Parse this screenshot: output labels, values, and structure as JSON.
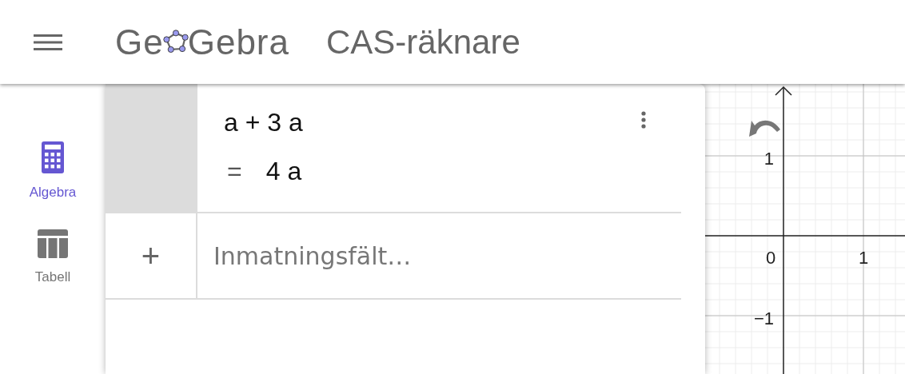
{
  "header": {
    "logo": [
      "Ge",
      "Gebra"
    ],
    "title": "CAS-räknare"
  },
  "sidebar": {
    "items": [
      {
        "label": "Algebra",
        "kind": "calculator",
        "selected": true
      },
      {
        "label": "Tabell",
        "kind": "table",
        "selected": false
      }
    ]
  },
  "cas": {
    "rows": [
      {
        "input": "a + 3 a",
        "output_sign": "=",
        "output": "4 a"
      }
    ],
    "new_row": {
      "icon": "+",
      "placeholder": "Inmatningsfält…"
    }
  },
  "graphics": {
    "x_labels": [
      "0",
      "1"
    ],
    "y_labels": [
      "1",
      "−1"
    ]
  }
}
